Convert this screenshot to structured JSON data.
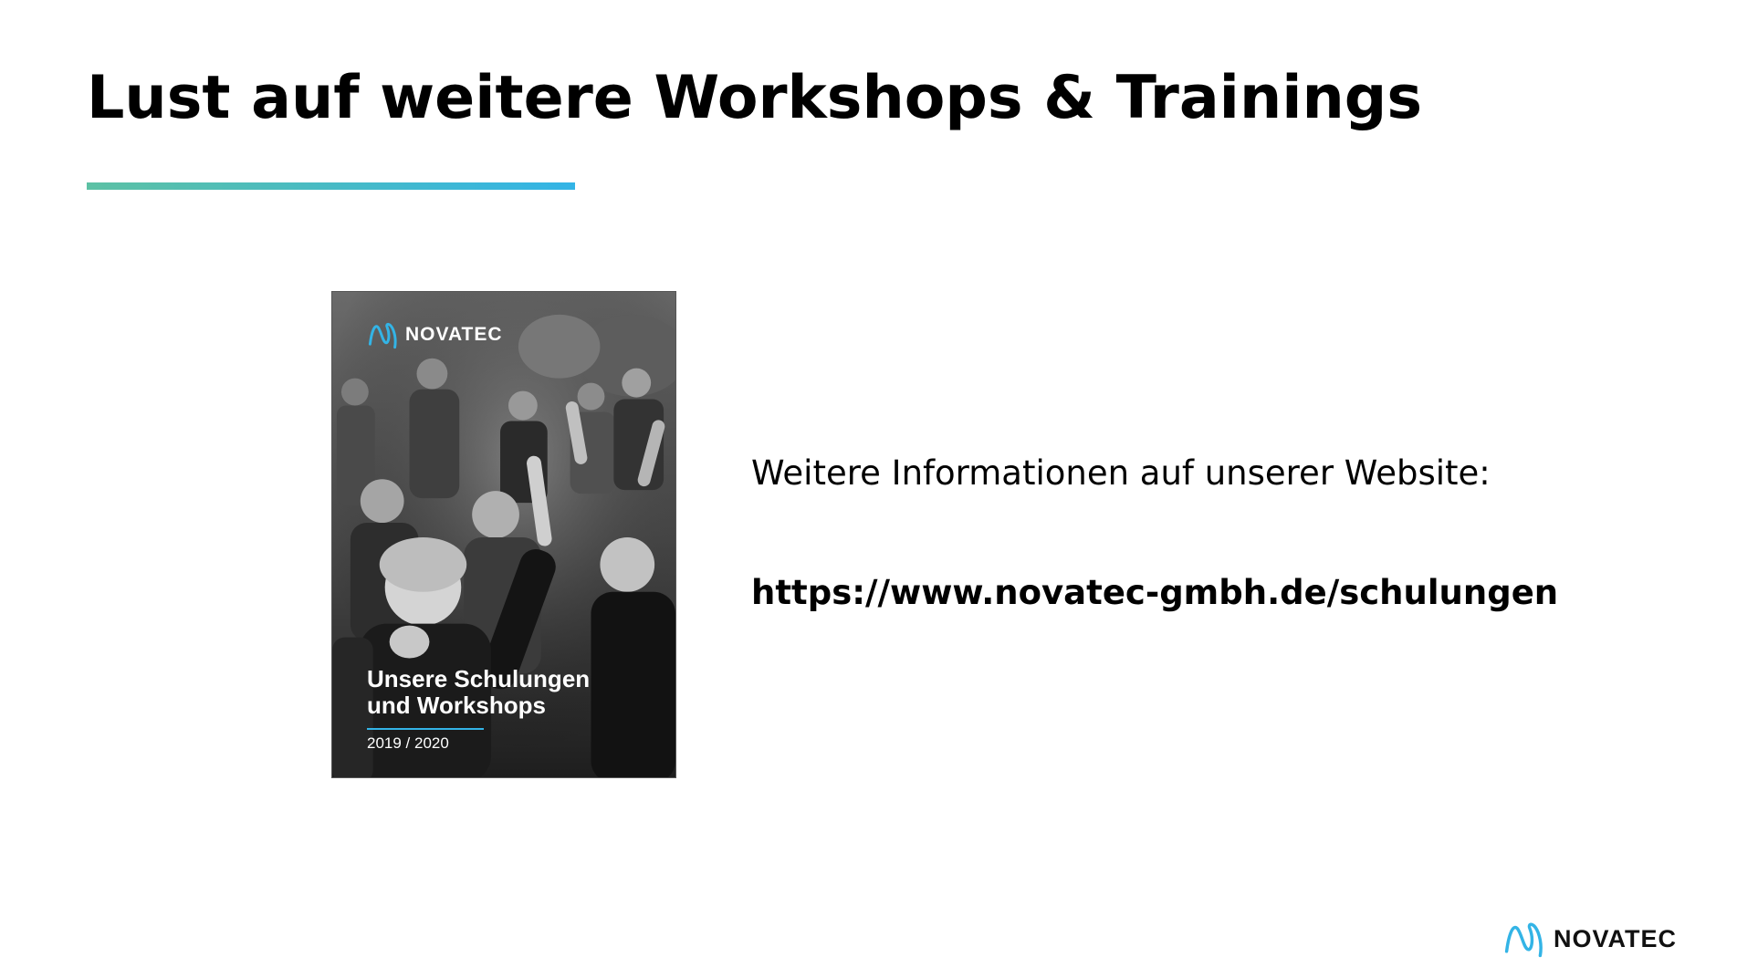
{
  "slide": {
    "title": "Lust auf weitere Workshops & Trainings",
    "accent_gradient": [
      "#5cc1a4",
      "#33b4e6"
    ]
  },
  "brochure": {
    "logo_text": "NOVATEC",
    "heading_line1": "Unsere Schulungen",
    "heading_line2": "und Workshops",
    "year": "2019 / 2020",
    "photo_desc_icon": "workshop-photo"
  },
  "info": {
    "text": "Weitere Informationen auf unserer Website:",
    "url": "https://www.novatec-gmbh.de/schulungen"
  },
  "footer": {
    "logo_text": "NOVATEC",
    "logo_color": "#33b4e6"
  }
}
